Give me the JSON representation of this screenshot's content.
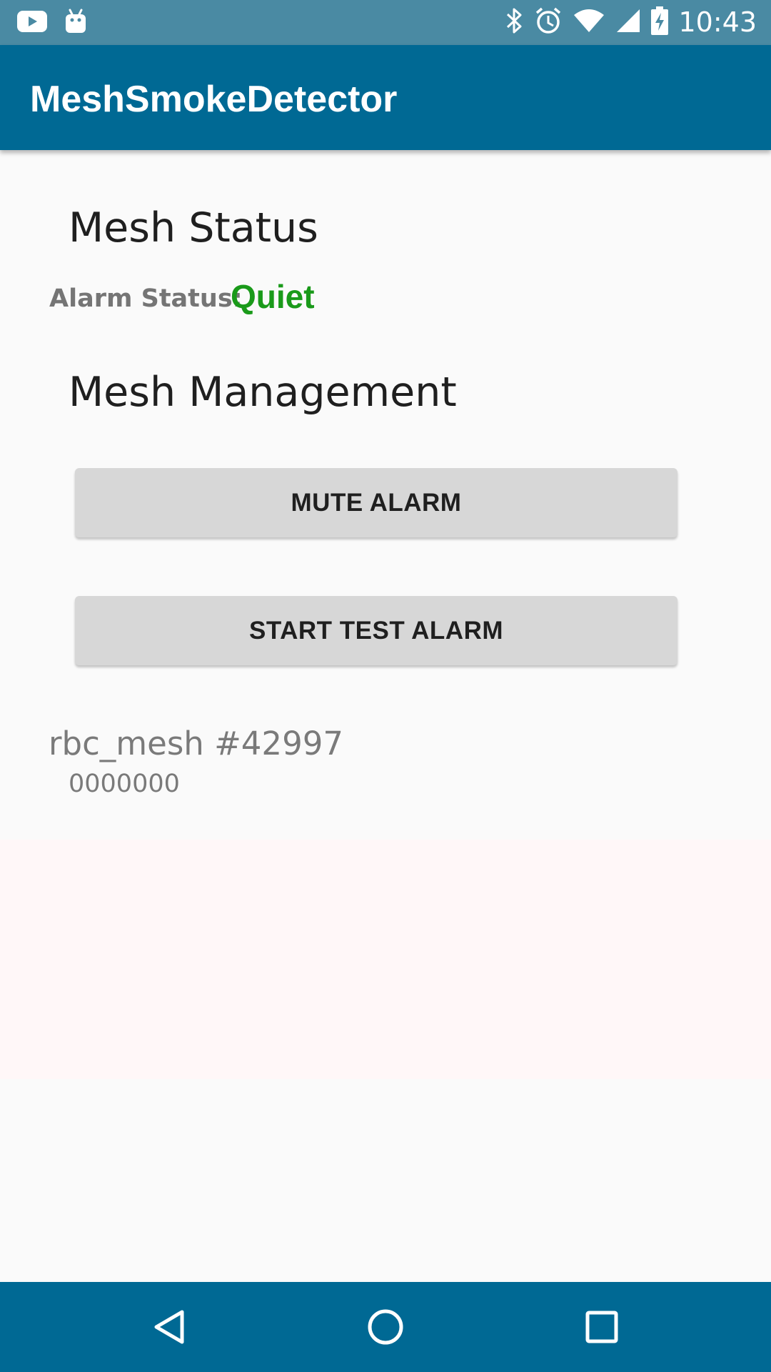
{
  "status_bar": {
    "time": "10:43",
    "left_icons": [
      "youtube-icon",
      "android-icon"
    ],
    "right_icons": [
      "bluetooth-icon",
      "alarm-clock-icon",
      "wifi-icon",
      "signal-icon",
      "battery-charging-icon"
    ]
  },
  "app_bar": {
    "title": "MeshSmokeDetector",
    "color": "#006994"
  },
  "mesh_status": {
    "title": "Mesh Status",
    "alarm_label": "Alarm Status:",
    "alarm_value": "Quiet",
    "alarm_value_color": "#1a9a1a"
  },
  "mesh_management": {
    "title": "Mesh Management",
    "mute_button": "MUTE ALARM",
    "test_button": "START TEST ALARM"
  },
  "mesh_info": {
    "name": "rbc_mesh #42997",
    "code": "0000000"
  },
  "nav_bar": {
    "icons": [
      "back-icon",
      "home-icon",
      "recents-icon"
    ]
  }
}
